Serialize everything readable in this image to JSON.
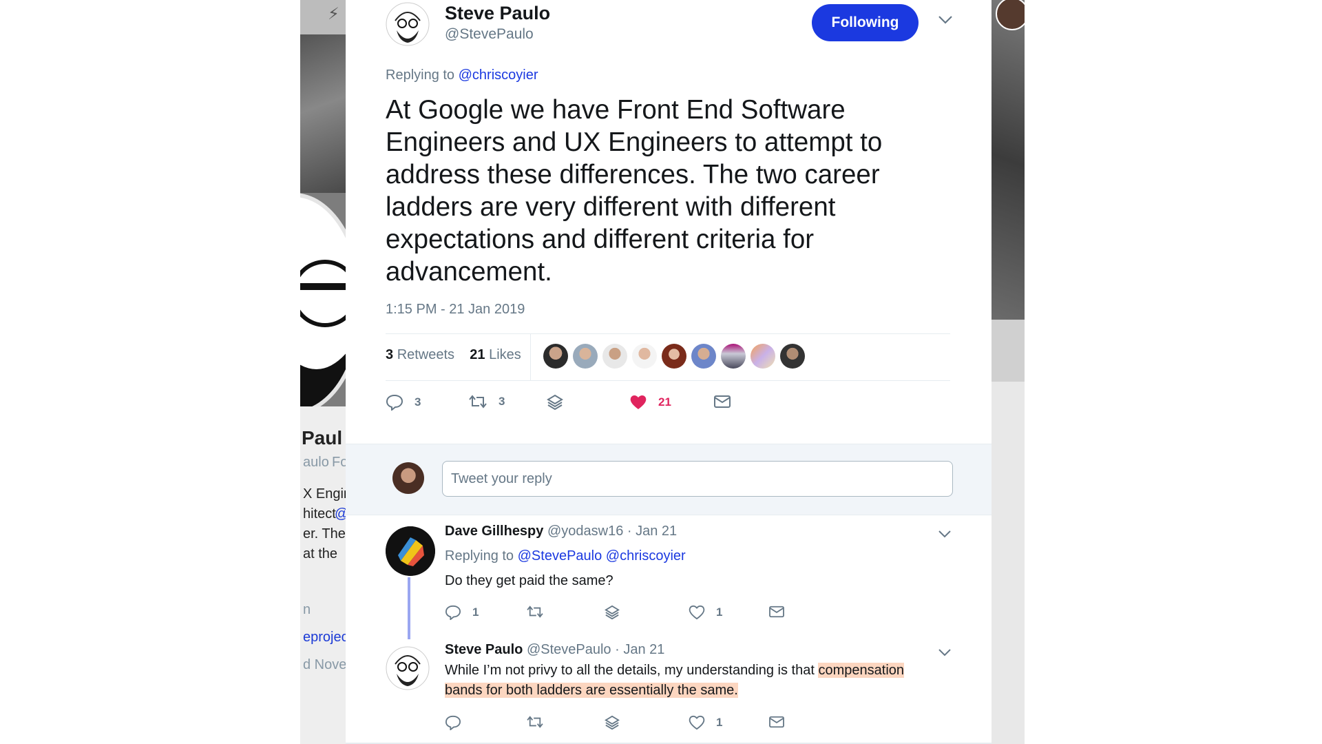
{
  "tweet": {
    "author_name": "Steve Paulo",
    "author_handle": "@StevePaulo",
    "follow_label": "Following",
    "replying_prefix": "Replying to",
    "replying_to": "@chriscoyier",
    "text": "At Google we have Front End Software Engineers and UX Engineers to attempt to address these differences. The two career ladders are very different with different expectations and different criteria for advancement.",
    "timestamp": "1:15 PM - 21 Jan 2019",
    "retweets_count": "3",
    "retweets_label": "Retweets",
    "likes_count": "21",
    "likes_label": "Likes",
    "actions": {
      "reply_count": "3",
      "retweet_count": "3",
      "like_count": "21"
    },
    "likers_count": 9
  },
  "reply_box": {
    "placeholder": "Tweet your reply"
  },
  "replies": [
    {
      "name": "Dave Gillhespy",
      "handle": "@yodasw16",
      "date": "· Jan 21",
      "replying_prefix": "Replying to",
      "replying_to_1": "@StevePaulo",
      "replying_to_2": "@chriscoyier",
      "text": "Do they get paid the same?",
      "reply_count": "1",
      "like_count": "1"
    },
    {
      "name": "Steve Paulo",
      "handle": "@StevePaulo",
      "date": "· Jan 21",
      "text_plain": "While I’m not privy to all the details, my understanding is that",
      "text_highlight_1": "compensation",
      "text_highlight_2": "bands for both ladders are essentially the same.",
      "like_count": "1"
    }
  ],
  "background_profile": {
    "name_fragment": "Paul",
    "handle_fragment": "aulo",
    "follow_fragment": "Fo",
    "bio_lines": [
      "X Engin",
      "hitect",
      "@",
      "er. The",
      "at the"
    ],
    "location_fragment": "n",
    "link_fragment": "eproject",
    "joined_fragment": "d Nover"
  },
  "colors": {
    "accent": "#1b39e0",
    "like": "#e0245e",
    "highlight": "#fcd6c0",
    "thread_line": "#9aa6f1"
  }
}
